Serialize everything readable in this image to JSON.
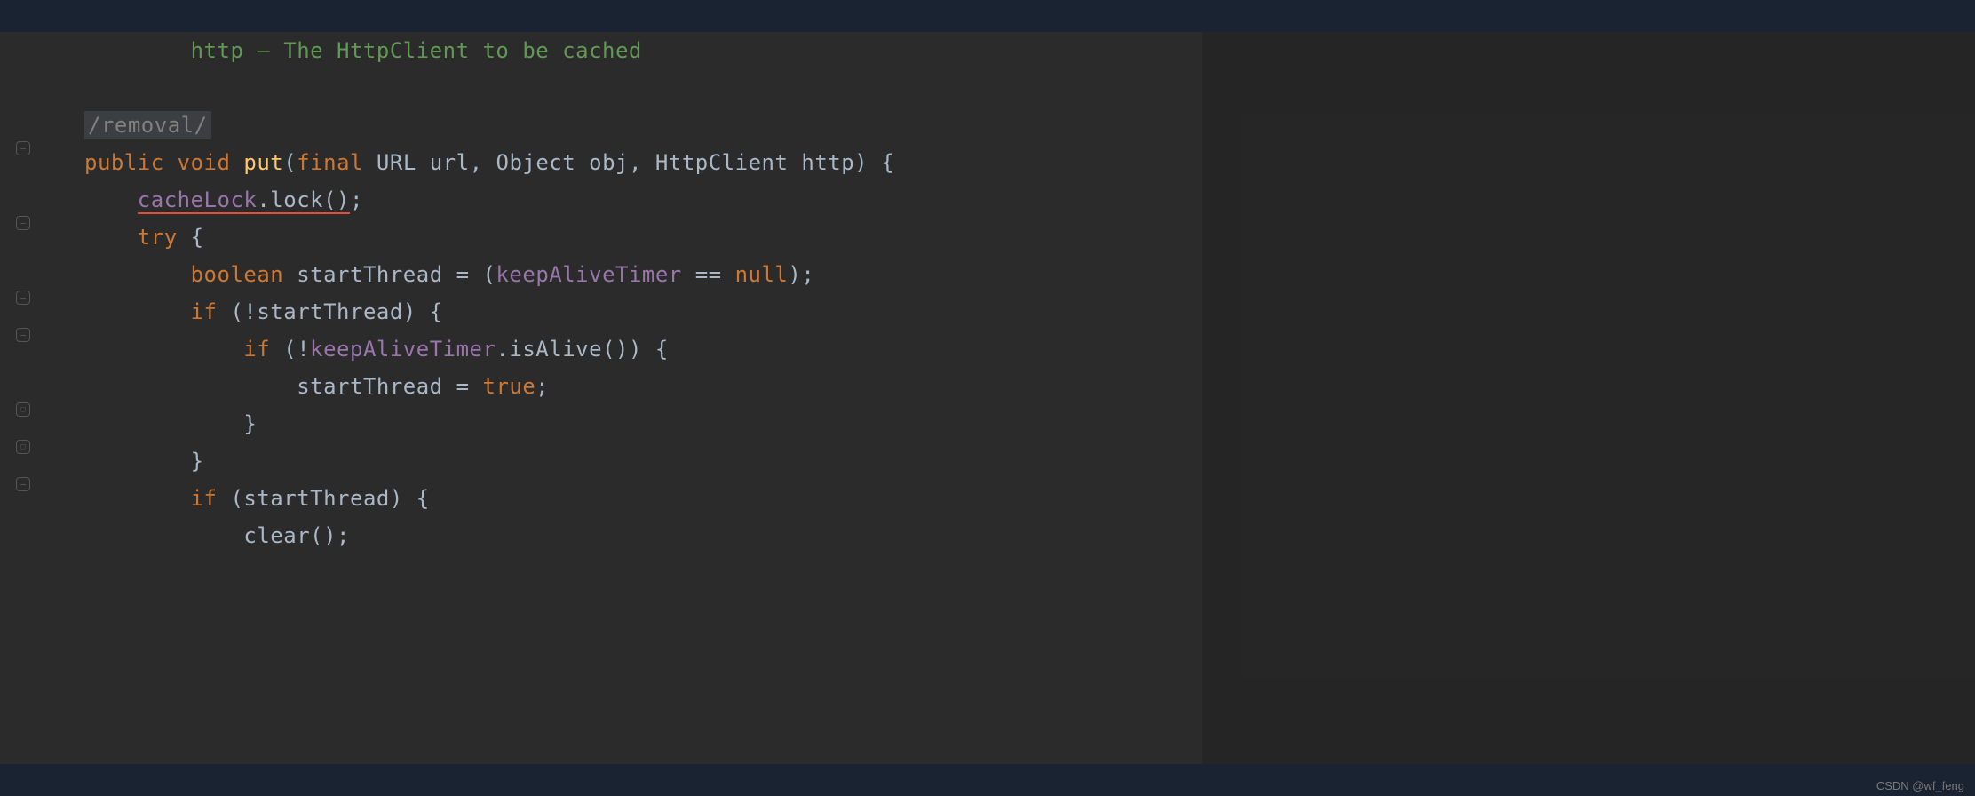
{
  "code": {
    "doc_comment": "        http – The HttpClient to be cached",
    "folded_doc": "/removal/",
    "line_public": "public",
    "line_void": "void",
    "line_put": "put",
    "line_final": "final",
    "line_url_type": "URL",
    "line_url_var": "url",
    "line_obj_type": "Object",
    "line_obj_var": "obj",
    "line_http_type": "HttpClient",
    "line_http_var": "http",
    "cacheLock": "cacheLock",
    "lock_method": "lock",
    "try_kw": "try",
    "boolean_kw": "boolean",
    "startThread": "startThread",
    "keepAliveTimer": "keepAliveTimer",
    "null_kw": "null",
    "if_kw": "if",
    "isAlive": "isAlive",
    "true_kw": "true",
    "clear_method": "clear"
  },
  "watermark": "CSDN @wf_feng"
}
